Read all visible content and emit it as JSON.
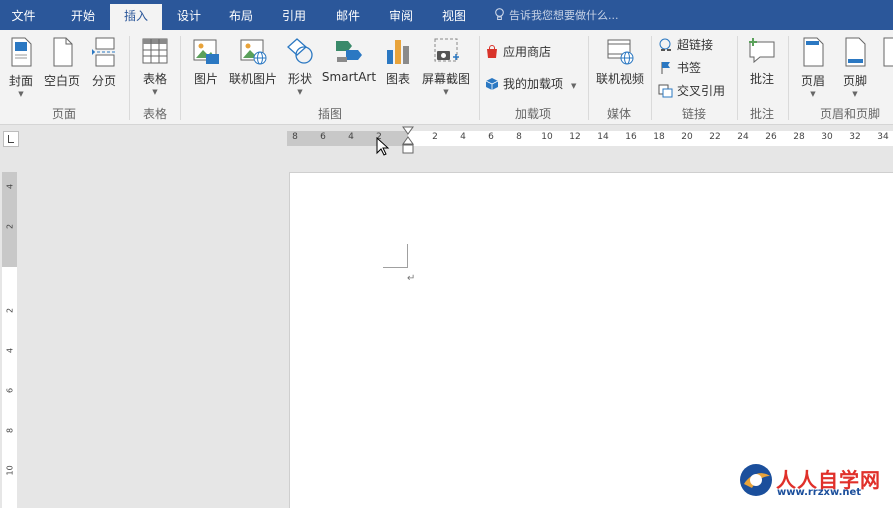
{
  "tabs": [
    {
      "label": "文件"
    },
    {
      "label": "开始"
    },
    {
      "label": "插入"
    },
    {
      "label": "设计"
    },
    {
      "label": "布局"
    },
    {
      "label": "引用"
    },
    {
      "label": "邮件"
    },
    {
      "label": "审阅"
    },
    {
      "label": "视图"
    }
  ],
  "active_tab": "插入",
  "tell_me": "告诉我您想要做什么...",
  "ribbon": {
    "cover_page": "封面",
    "blank_page": "空白页",
    "page_break": "分页",
    "table": "表格",
    "picture": "图片",
    "online_picture": "联机图片",
    "shapes": "形状",
    "smartart": "SmartArt",
    "chart": "图表",
    "screenshot": "屏幕截图",
    "store": "应用商店",
    "my_addins": "我的加载项",
    "online_video": "联机视频",
    "hyperlink": "超链接",
    "bookmark": "书签",
    "cross_ref": "交叉引用",
    "comment": "批注",
    "header": "页眉",
    "footer": "页脚",
    "groups": {
      "pages": "页面",
      "tables": "表格",
      "illustrations": "插图",
      "addins": "加载项",
      "media": "媒体",
      "links": "链接",
      "comments": "批注",
      "header_footer": "页眉和页脚"
    }
  },
  "ruler_h": [
    "8",
    "6",
    "4",
    "2",
    "2",
    "4",
    "6",
    "8",
    "10",
    "12",
    "14",
    "16",
    "18",
    "20",
    "22",
    "24",
    "26",
    "28",
    "30",
    "32",
    "34"
  ],
  "ruler_v": [
    "4",
    "2",
    "2",
    "4",
    "6",
    "8",
    "10"
  ],
  "paragraph_mark": "↵",
  "watermark": {
    "text": "人人自学网",
    "url": "www.rrzxw.net"
  },
  "colors": {
    "accent": "#2b579a",
    "ribbon_bg": "#f3f3f3",
    "watermark_red": "#e0302a",
    "watermark_blue": "#1b4f9c"
  }
}
